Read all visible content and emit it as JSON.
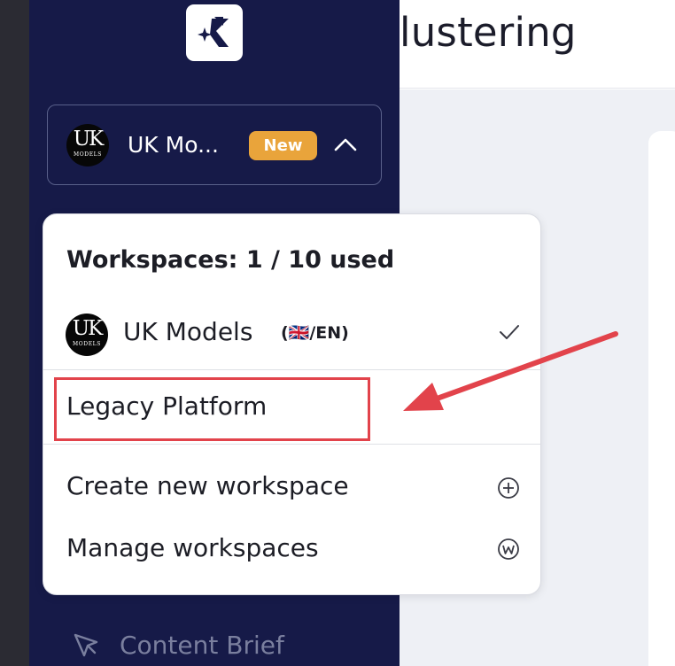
{
  "page": {
    "title": "lustering"
  },
  "sidebar": {
    "logo_icon": "sparkle-k-logo-icon",
    "workspace_switcher": {
      "avatar_text": "UK",
      "avatar_subtext": "MODELS",
      "name": "UK Mo...",
      "badge": "New",
      "toggle_icon": "chevron-up-icon"
    },
    "nav_item": {
      "label": "Content Brief",
      "icon": "cursor-pointer-icon"
    }
  },
  "workspace_menu": {
    "heading": "Workspaces: 1 / 10 used",
    "workspaces": [
      {
        "avatar_text": "UK",
        "avatar_subtext": "MODELS",
        "name": "UK Models",
        "locale": "(🇬🇧/EN)",
        "selected": true,
        "status_icon": "checkmark-icon"
      }
    ],
    "legacy_item": {
      "label": "Legacy Platform"
    },
    "actions": [
      {
        "label": "Create new workspace",
        "icon": "plus-circle-icon"
      },
      {
        "label": "Manage workspaces",
        "icon": "w-circle-icon"
      }
    ]
  },
  "annotation": {
    "highlight_color": "#e2434b"
  },
  "colors": {
    "sidebar_bg": "#161a48",
    "badge_bg": "#e9a43b",
    "main_bg": "#eef0f5"
  }
}
